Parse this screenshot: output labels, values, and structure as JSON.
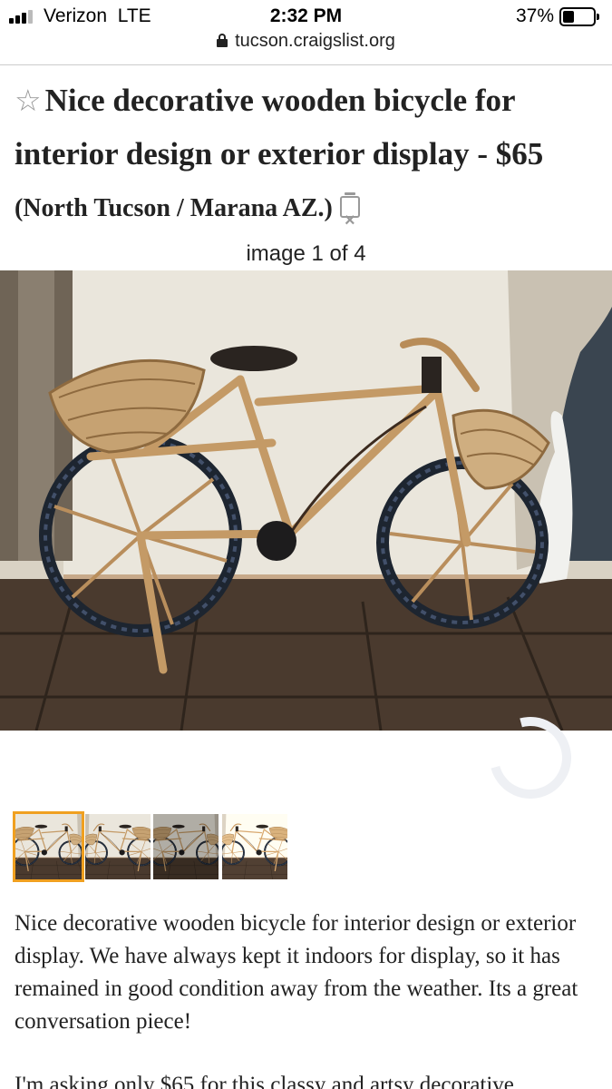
{
  "status_bar": {
    "carrier": "Verizon",
    "network": "LTE",
    "time": "2:32 PM",
    "battery_percent": "37%",
    "battery_level": 0.37
  },
  "browser": {
    "url": "tucson.craigslist.org"
  },
  "posting": {
    "title": "Nice decorative wooden bicycle for interior design or exterior display -",
    "price": "$65",
    "location": "(North Tucson / Marana AZ.)",
    "image_counter": "image 1 of 4",
    "thumbnails": [
      "thumb-1",
      "thumb-2",
      "thumb-3",
      "thumb-4"
    ],
    "active_thumbnail": 0
  },
  "description": {
    "para1": "Nice decorative wooden bicycle for interior design or exterior display. We have always kept it indoors for display, so it has remained in good condition away from the weather. Its a great conversation piece!",
    "para2": "I'm asking only $65 for this classy and artsy decorative"
  },
  "icons": {
    "favorite": "star-icon",
    "hide": "trash-x-icon",
    "secure": "lock-icon"
  },
  "colors": {
    "active_thumbnail_border": "#f0a020",
    "text": "#222222"
  }
}
